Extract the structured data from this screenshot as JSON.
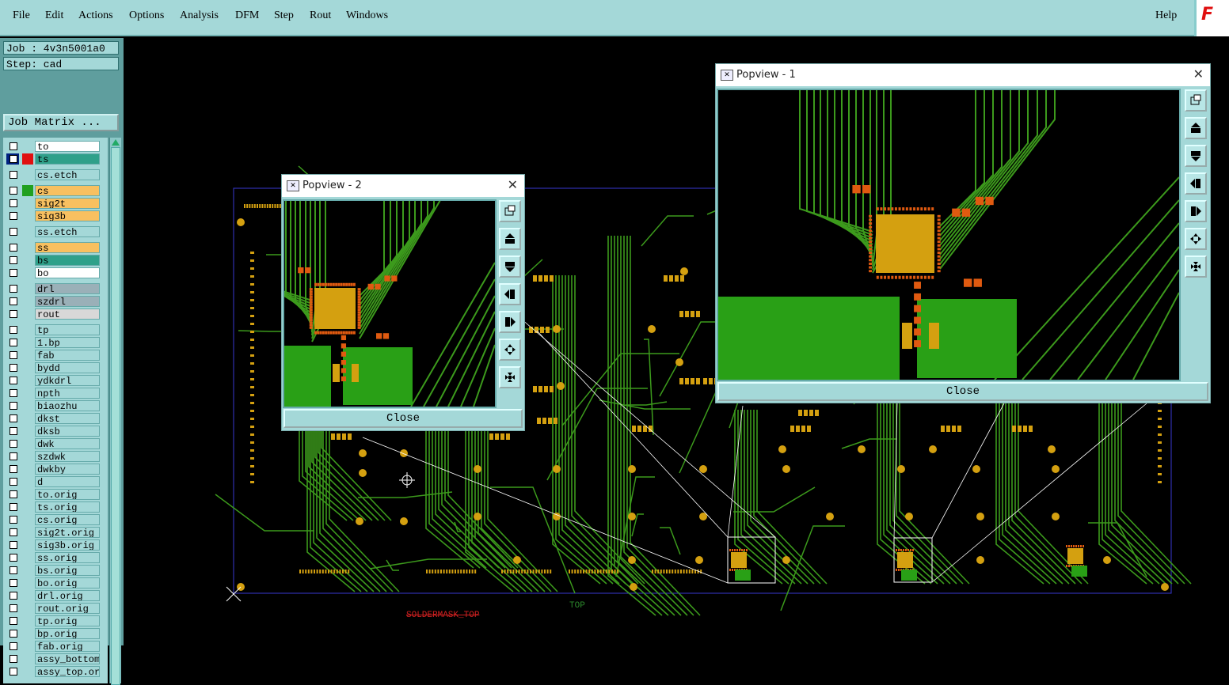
{
  "menu": {
    "file": "File",
    "edit": "Edit",
    "actions": "Actions",
    "options": "Options",
    "analysis": "Analysis",
    "dfm": "DFM",
    "step": "Step",
    "rout": "Rout",
    "windows": "Windows",
    "help": "Help"
  },
  "logo": "F",
  "job": {
    "job_label": "Job : 4v3n5001a0",
    "step_label": "Step: cad",
    "matrix_button": "Job Matrix ..."
  },
  "layers": [
    {
      "name": "to",
      "color": "#ffffff",
      "swatch": "",
      "dot": "#8a4"
    },
    {
      "name": "ts",
      "color": "#2fa08a",
      "swatch": "#e01010",
      "boxcolor": "#002080"
    },
    {
      "name": "cs.etch",
      "color": "#a4d8d8",
      "swatch": ""
    },
    {
      "name": "cs",
      "color": "#f8c060",
      "swatch": "#20a020"
    },
    {
      "name": "sig2t",
      "color": "#f8c060",
      "swatch": ""
    },
    {
      "name": "sig3b",
      "color": "#f8c060",
      "swatch": ""
    },
    {
      "name": "ss.etch",
      "color": "#a4d8d8",
      "swatch": ""
    },
    {
      "name": "ss",
      "color": "#f8c060",
      "swatch": ""
    },
    {
      "name": "bs",
      "color": "#2fa08a",
      "swatch": ""
    },
    {
      "name": "bo",
      "color": "#ffffff",
      "swatch": ""
    },
    {
      "name": "drl",
      "color": "#9ab0b8",
      "swatch": ""
    },
    {
      "name": "szdrl",
      "color": "#9ab0b8",
      "swatch": ""
    },
    {
      "name": "rout",
      "color": "#d8d8d8",
      "swatch": ""
    },
    {
      "name": "tp",
      "color": "#a4d8d8",
      "swatch": ""
    },
    {
      "name": "1.bp",
      "color": "#a4d8d8",
      "swatch": ""
    },
    {
      "name": "fab",
      "color": "#a4d8d8",
      "swatch": ""
    },
    {
      "name": "bydd",
      "color": "#a4d8d8",
      "swatch": ""
    },
    {
      "name": "ydkdrl",
      "color": "#a4d8d8",
      "swatch": ""
    },
    {
      "name": "npth",
      "color": "#a4d8d8",
      "swatch": ""
    },
    {
      "name": "biaozhu",
      "color": "#a4d8d8",
      "swatch": ""
    },
    {
      "name": "dkst",
      "color": "#a4d8d8",
      "swatch": ""
    },
    {
      "name": "dksb",
      "color": "#a4d8d8",
      "swatch": ""
    },
    {
      "name": "dwk",
      "color": "#a4d8d8",
      "swatch": ""
    },
    {
      "name": "szdwk",
      "color": "#a4d8d8",
      "swatch": ""
    },
    {
      "name": "dwkby",
      "color": "#a4d8d8",
      "swatch": ""
    },
    {
      "name": "d",
      "color": "#a4d8d8",
      "swatch": ""
    },
    {
      "name": "to.orig",
      "color": "#a4d8d8",
      "swatch": ""
    },
    {
      "name": "ts.orig",
      "color": "#a4d8d8",
      "swatch": ""
    },
    {
      "name": "cs.orig",
      "color": "#a4d8d8",
      "swatch": ""
    },
    {
      "name": "sig2t.orig",
      "color": "#a4d8d8",
      "swatch": ""
    },
    {
      "name": "sig3b.orig",
      "color": "#a4d8d8",
      "swatch": ""
    },
    {
      "name": "ss.orig",
      "color": "#a4d8d8",
      "swatch": ""
    },
    {
      "name": "bs.orig",
      "color": "#a4d8d8",
      "swatch": ""
    },
    {
      "name": "bo.orig",
      "color": "#a4d8d8",
      "swatch": ""
    },
    {
      "name": "drl.orig",
      "color": "#a4d8d8",
      "swatch": ""
    },
    {
      "name": "rout.orig",
      "color": "#a4d8d8",
      "swatch": ""
    },
    {
      "name": "tp.orig",
      "color": "#a4d8d8",
      "swatch": ""
    },
    {
      "name": "bp.orig",
      "color": "#a4d8d8",
      "swatch": ""
    },
    {
      "name": "fab.orig",
      "color": "#a4d8d8",
      "swatch": ""
    },
    {
      "name": "assy_bottom",
      "color": "#a4d8d8",
      "swatch": ""
    },
    {
      "name": "assy_top.ori",
      "color": "#a4d8d8",
      "swatch": ""
    }
  ],
  "board": {
    "label_soldermask": "SOLDERMASK_TOP",
    "label_top": "TOP"
  },
  "popview1": {
    "title": "Popview - 1",
    "close": "Close"
  },
  "popview2": {
    "title": "Popview - 2",
    "close": "Close"
  },
  "colors": {
    "trace": "#3c9a1c",
    "pad": "#d4a010",
    "smd": "#e05a10",
    "frame": "#3838d0"
  }
}
